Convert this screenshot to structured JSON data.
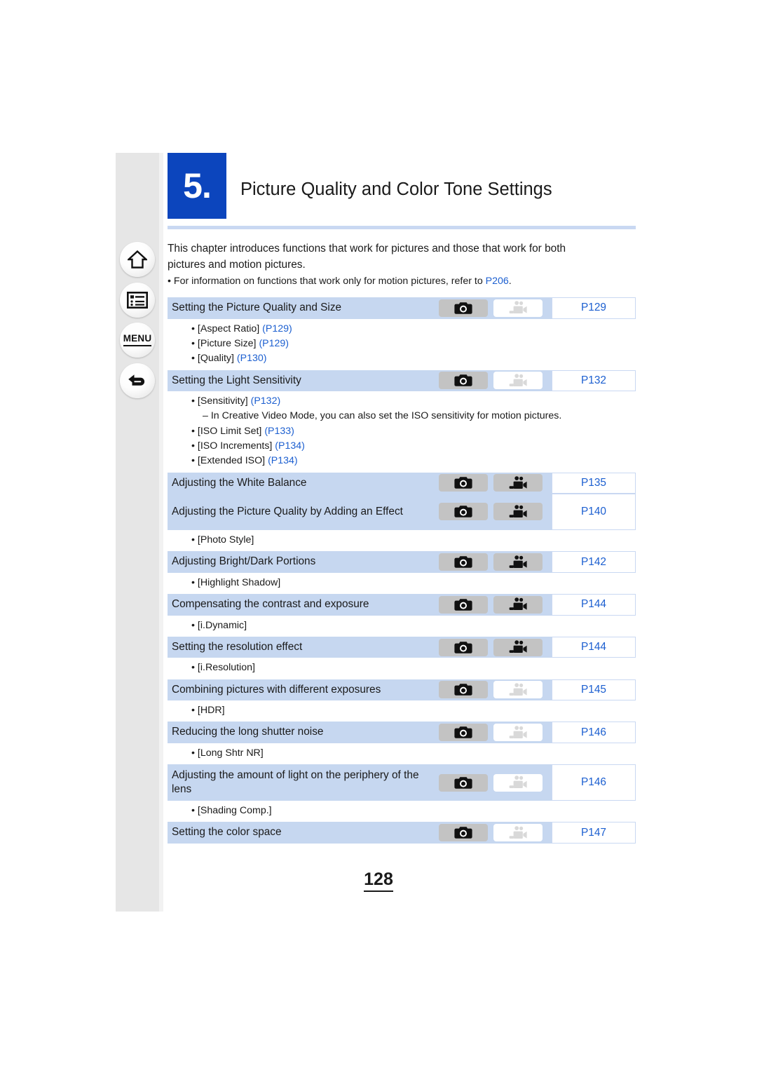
{
  "sidebar": {
    "buttons": [
      {
        "name": "home",
        "label": ""
      },
      {
        "name": "contents",
        "label": ""
      },
      {
        "name": "menu",
        "label": "MENU"
      },
      {
        "name": "back",
        "label": ""
      }
    ]
  },
  "header": {
    "number": "5.",
    "title": "Picture Quality and Color Tone Settings",
    "accent_color": "#0c45bd",
    "rule_color": "#c9d8f2"
  },
  "intro": {
    "line1": "This chapter introduces functions that work for pictures and those that work for both",
    "line2": "pictures and motion pictures.",
    "bullet_prefix": "• For information on functions that work only for motion pictures, refer to ",
    "bullet_link": "P206",
    "bullet_suffix": "."
  },
  "colors": {
    "row_bg": "#c6d7f0",
    "link": "#1c5fd0",
    "pill_on": "#c3c3c3",
    "pill_off": "#ffffff"
  },
  "toc": {
    "rows": [
      {
        "title": "Setting the Picture Quality and Size",
        "photo": "on",
        "video": "off",
        "page": "P129",
        "tall": false,
        "subs": [
          {
            "text": "• [Aspect Ratio] ",
            "link": "(P129)",
            "dash": false
          },
          {
            "text": "• [Picture Size] ",
            "link": "(P129)",
            "dash": false
          },
          {
            "text": "• [Quality] ",
            "link": "(P130)",
            "dash": false
          }
        ]
      },
      {
        "title": "Setting the Light Sensitivity",
        "photo": "on",
        "video": "off",
        "page": "P132",
        "tall": false,
        "subs": [
          {
            "text": "• [Sensitivity] ",
            "link": "(P132)",
            "dash": false
          },
          {
            "text": "– In Creative Video Mode, you can also set the ISO sensitivity for motion pictures.",
            "link": "",
            "dash": true
          },
          {
            "text": "• [ISO Limit Set] ",
            "link": "(P133)",
            "dash": false
          },
          {
            "text": "• [ISO Increments] ",
            "link": "(P134)",
            "dash": false
          },
          {
            "text": "• [Extended ISO] ",
            "link": "(P134)",
            "dash": false
          }
        ]
      },
      {
        "title": "Adjusting the White Balance",
        "photo": "on",
        "video": "on",
        "page": "P135",
        "tall": false,
        "subs": []
      },
      {
        "title": "Adjusting the Picture Quality by Adding an Effect",
        "photo": "on",
        "video": "on",
        "page": "P140",
        "tall": true,
        "subs": [
          {
            "text": "• [Photo Style]",
            "link": "",
            "dash": false
          }
        ]
      },
      {
        "title": "Adjusting Bright/Dark Portions",
        "photo": "on",
        "video": "on",
        "page": "P142",
        "tall": false,
        "subs": [
          {
            "text": "• [Highlight Shadow]",
            "link": "",
            "dash": false
          }
        ]
      },
      {
        "title": "Compensating the contrast and exposure",
        "photo": "on",
        "video": "on",
        "page": "P144",
        "tall": false,
        "subs": [
          {
            "text": "• [i.Dynamic]",
            "link": "",
            "dash": false
          }
        ]
      },
      {
        "title": "Setting the resolution effect",
        "photo": "on",
        "video": "on",
        "page": "P144",
        "tall": false,
        "subs": [
          {
            "text": "• [i.Resolution]",
            "link": "",
            "dash": false
          }
        ]
      },
      {
        "title": "Combining pictures with different exposures",
        "photo": "on",
        "video": "off",
        "page": "P145",
        "tall": false,
        "subs": [
          {
            "text": "• [HDR]",
            "link": "",
            "dash": false
          }
        ]
      },
      {
        "title": "Reducing the long shutter noise",
        "photo": "on",
        "video": "off",
        "page": "P146",
        "tall": false,
        "subs": [
          {
            "text": "• [Long Shtr NR]",
            "link": "",
            "dash": false
          }
        ]
      },
      {
        "title": "Adjusting the amount of light on the periphery of the lens",
        "photo": "on",
        "video": "off",
        "page": "P146",
        "tall": true,
        "subs": [
          {
            "text": "• [Shading Comp.]",
            "link": "",
            "dash": false
          }
        ]
      },
      {
        "title": "Setting the color space",
        "photo": "on",
        "video": "off",
        "page": "P147",
        "tall": false,
        "subs": []
      }
    ]
  },
  "footer": {
    "page_number": "128"
  }
}
